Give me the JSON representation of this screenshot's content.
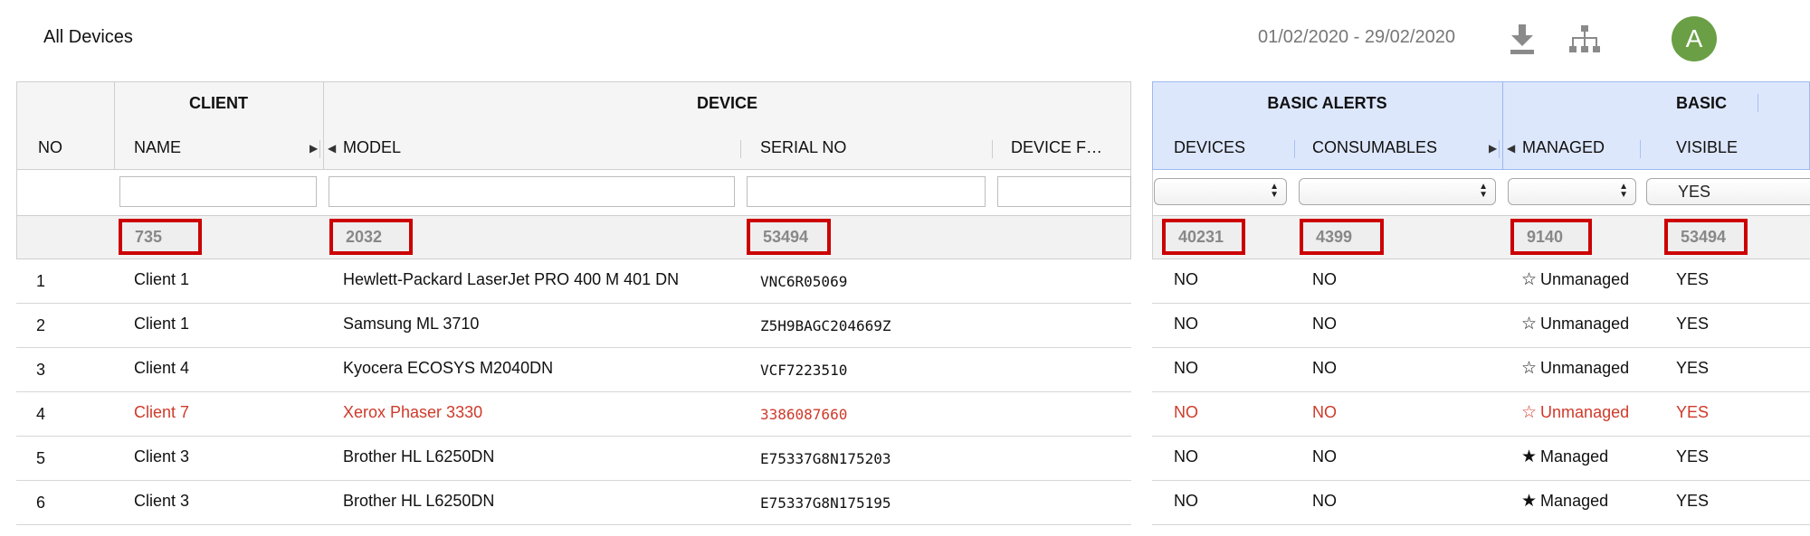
{
  "header": {
    "title": "All Devices",
    "date_range": "01/02/2020 - 29/02/2020",
    "download_icon": "download-icon",
    "hierarchy_icon": "sitemap-icon",
    "avatar_letter": "A"
  },
  "columns": {
    "no": "NO",
    "client_group": "CLIENT",
    "name": "NAME",
    "device_group": "DEVICE",
    "model": "MODEL",
    "serial_no": "SERIAL NO",
    "device_f": "DEVICE F…",
    "basic_alerts_group": "BASIC ALERTS",
    "devices": "DEVICES",
    "consumables": "CONSUMABLES",
    "basic_group": "BASIC",
    "managed": "MANAGED",
    "visible": "VISIBLE"
  },
  "filters": {
    "visible_selected": "YES"
  },
  "totals": {
    "name": "735",
    "model": "2032",
    "serial_no": "53494",
    "devices": "40231",
    "consumables": "4399",
    "managed": "9140",
    "visible": "53494"
  },
  "rows": [
    {
      "no": "1",
      "client": "Client 1",
      "model": "Hewlett-Packard LaserJet PRO 400 M 401 DN",
      "serial": "VNC6R05069",
      "devices": "NO",
      "consumables": "NO",
      "managed": "Unmanaged",
      "managed_star": "☆",
      "visible": "YES"
    },
    {
      "no": "2",
      "client": "Client 1",
      "model": "Samsung ML 3710",
      "serial": "Z5H9BAGC204669Z",
      "devices": "NO",
      "consumables": "NO",
      "managed": "Unmanaged",
      "managed_star": "☆",
      "visible": "YES"
    },
    {
      "no": "3",
      "client": "Client 4",
      "model": "Kyocera ECOSYS M2040DN",
      "serial": "VCF7223510",
      "devices": "NO",
      "consumables": "NO",
      "managed": "Unmanaged",
      "managed_star": "☆",
      "visible": "YES"
    },
    {
      "no": "4",
      "client": "Client 7",
      "model": "Xerox Phaser 3330",
      "serial": "3386087660",
      "devices": "NO",
      "consumables": "NO",
      "managed": "Unmanaged",
      "managed_star": "☆",
      "visible": "YES"
    },
    {
      "no": "5",
      "client": "Client 3",
      "model": "Brother HL L6250DN",
      "serial": "E75337G8N175203",
      "devices": "NO",
      "consumables": "NO",
      "managed": "Managed",
      "managed_star": "★",
      "visible": "YES"
    },
    {
      "no": "6",
      "client": "Client 3",
      "model": "Brother HL L6250DN",
      "serial": "E75337G8N175195",
      "devices": "NO",
      "consumables": "NO",
      "managed": "Managed",
      "managed_star": "★",
      "visible": "YES"
    }
  ],
  "colors": {
    "highlight_row_text": "#cf3a2a",
    "total_box_border": "#cc0000",
    "alerts_header_bg": "#dde7fc",
    "avatar_bg": "#6a9f46"
  }
}
